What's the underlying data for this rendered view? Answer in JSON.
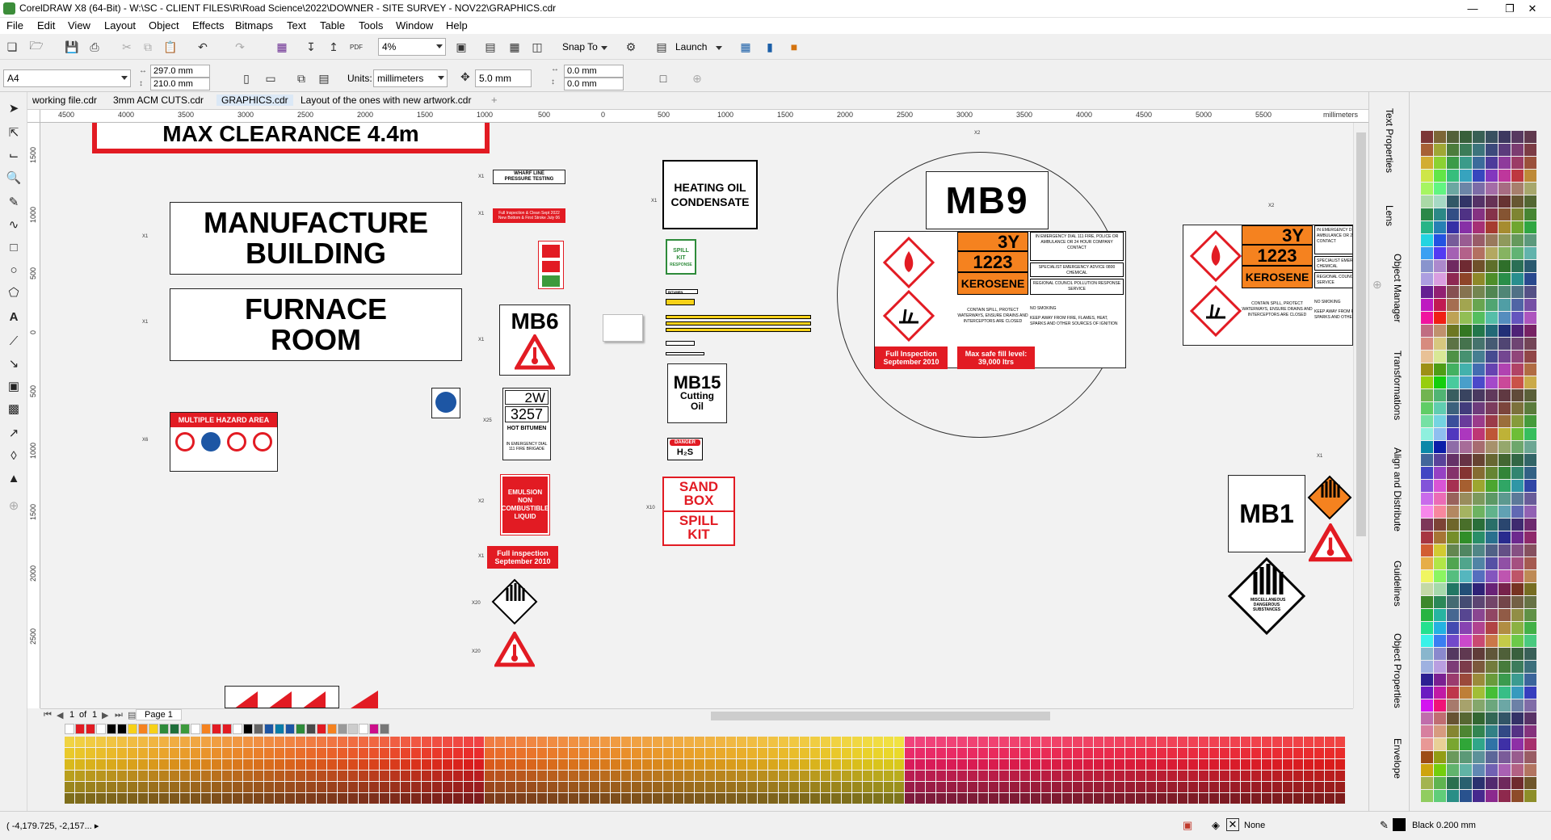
{
  "window": {
    "title": "CorelDRAW X8 (64-Bit) - W:\\SC - CLIENT FILES\\R\\Road Science\\2022\\DOWNER - SITE SURVEY - NOV22\\GRAPHICS.cdr"
  },
  "menu": [
    "File",
    "Edit",
    "View",
    "Layout",
    "Object",
    "Effects",
    "Bitmaps",
    "Text",
    "Table",
    "Tools",
    "Window",
    "Help"
  ],
  "toolbar": {
    "zoom": "4%",
    "snap_label": "Snap To",
    "launch_label": "Launch"
  },
  "propbar": {
    "page_size": "A4",
    "width": "297.0 mm",
    "height": "210.0 mm",
    "units_label": "Units:",
    "units": "millimeters",
    "nudge": "5.0 mm",
    "dup_x": "0.0 mm",
    "dup_y": "0.0 mm"
  },
  "doc_tabs": [
    "working file.cdr",
    "3mm ACM CUTS.cdr",
    "GRAPHICS.cdr",
    "Layout of the ones with new artwork.cdr"
  ],
  "ruler": {
    "unit": "millimeters",
    "h_ticks": [
      "4500",
      "4000",
      "3500",
      "3000",
      "2500",
      "2000",
      "1500",
      "1000",
      "500",
      "0",
      "500",
      "1000",
      "1500",
      "2000",
      "2500",
      "3000",
      "3500",
      "4000",
      "4500",
      "5000",
      "5500"
    ],
    "v_ticks": [
      "1500",
      "1000",
      "500",
      "0",
      "500",
      "1000",
      "1500",
      "2000",
      "2500"
    ]
  },
  "page_nav": {
    "current": "1",
    "of_label": "of",
    "total": "1",
    "page_tab": "Page 1"
  },
  "docker_tabs": [
    "Text Properties",
    "Lens",
    "Object Manager",
    "Transformations",
    "Align and Distribute",
    "Guidelines",
    "Object Properties",
    "Envelope"
  ],
  "status": {
    "coords": "( -4,179.725, -2,157... ▸",
    "fill": "None",
    "outline": "Black 0.200 mm"
  },
  "artwork": {
    "max_clearance": "MAX CLEARANCE 4.4m",
    "manufacture_1": "MANUFACTURE",
    "manufacture_2": "BUILDING",
    "furnace_1": "FURNACE",
    "furnace_2": "ROOM",
    "multi_hazard": "MULTIPLE HAZARD AREA",
    "wharf_1": "WHARF LINE",
    "wharf_2": "PRESSURE TESTING",
    "full_insp_small": "Full Inspection & Clean Sept 2022",
    "full_insp_small2": "New Bottom & First Stroke July 06",
    "mb6": "MB6",
    "w2": "2W",
    "un3257": "3257",
    "hot_bitumen": "HOT BITUMEN",
    "emergency_small": "IN EMERGENCY DIAL 111 FIRE BRIGADE",
    "emulsion_1": "EMULSION",
    "emulsion_2": "NON",
    "emulsion_3": "COMBUSTIBLE",
    "emulsion_4": "LIQUID",
    "full_insp_1": "Full inspection",
    "full_insp_2": "September 2010",
    "heating_1": "HEATING OIL",
    "heating_2": "CONDENSATE",
    "spill_kit_1": "SPILL",
    "spill_kit_2": "KIT",
    "spill_kit_3": "RESPONSE",
    "bitumen_tag": "BITUMEN",
    "mb15": "MB15",
    "cutting_1": "Cutting",
    "cutting_2": "Oil",
    "danger": "DANGER",
    "h2s": "H₂S",
    "sand_1": "SAND",
    "sand_2": "BOX",
    "spill_1": "SPILL",
    "spill_2": "KIT",
    "mb9": "MB9",
    "code_3y": "3Y",
    "code_1223": "1223",
    "kerosene": "KEROSENE",
    "emerg_text": "IN EMERGENCY DIAL 111 FIRE, POLICE OR AMBULANCE OR 24 HOUR COMPANY CONTACT",
    "specialist": "SPECIALIST EMERGENCY ADVICE 0800 CHEMICAL",
    "regional": "REGIONAL COUNCIL POLLUTION RESPONSE SERVICE",
    "contain": "CONTAIN SPILL, PROTECT WATERWAYS, ENSURE DRAINS AND INTERCEPTORS ARE CLOSED",
    "no_smoking": "NO SMOKING",
    "keep_away": "KEEP AWAY FROM FIRE, FLAMES, HEAT, SPARKS AND OTHER SOURCES OF IGNITION",
    "full_insp_sept": "Full Inspection September 2010",
    "max_fill": "Max safe fill level: 39,000 ltrs",
    "mb1": "MB1",
    "misc_dangerous": "MISCELLANEOUS DANGEROUS SUBSTANCES",
    "qty_x1": "X1",
    "qty_x2": "X2",
    "qty_x6": "X6",
    "qty_x10": "X10",
    "qty_x20": "X20",
    "qty_x25": "X25",
    "qty_x50": "X50"
  },
  "colors": {
    "accent_red": "#e21b23",
    "orange": "#f5821f",
    "selected_tab": "#dbe8f6"
  }
}
